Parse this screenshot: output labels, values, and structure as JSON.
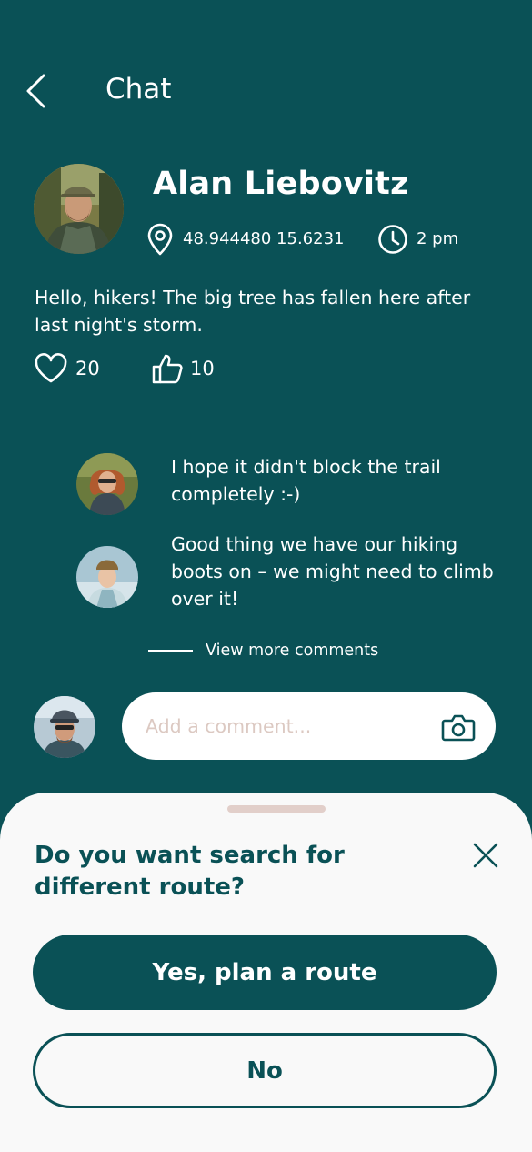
{
  "header": {
    "title": "Chat",
    "back_icon": "chevron-left-icon"
  },
  "post": {
    "author": "Alan Liebovitz",
    "location": "48.944480 15.6231",
    "time": "2 pm",
    "text": "Hello, hikers! The big tree has fallen here after last night's storm.",
    "likes": "20",
    "thumbs_up": "10",
    "icons": [
      "location-pin-icon",
      "clock-icon",
      "heart-icon",
      "thumbs-up-icon"
    ]
  },
  "comments": [
    {
      "text": "I hope it didn't block the trail completely :-)"
    },
    {
      "text": "Good thing we have our hiking boots on – we might need to climb over it!"
    }
  ],
  "view_more": "View more comments",
  "composer": {
    "placeholder": "Add a comment...",
    "icon": "camera-icon"
  },
  "sheet": {
    "title": "Do you want search for different route?",
    "primary_label": "Yes, plan a route",
    "secondary_label": "No",
    "close_icon": "close-icon"
  },
  "colors": {
    "background": "#0a5156",
    "sheet": "#f9f9f9",
    "placeholder": "#dcc9c2",
    "grabber": "#e2cfca"
  }
}
